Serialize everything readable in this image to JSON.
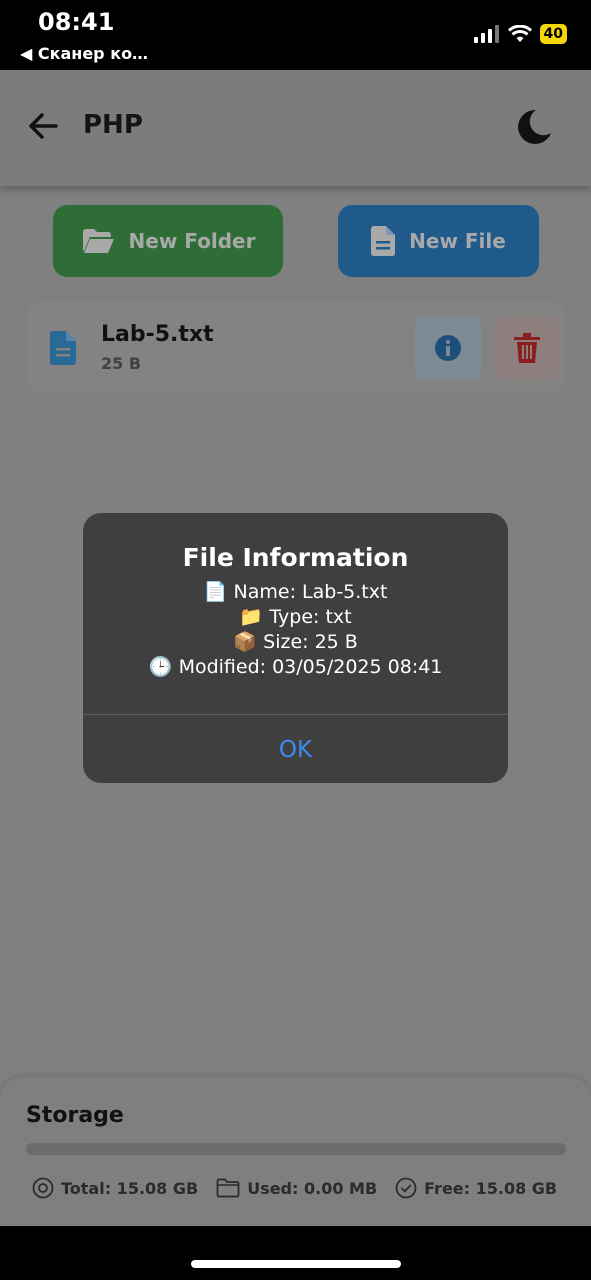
{
  "status_bar": {
    "time": "08:41",
    "back_app": "◀ Сканер ко…",
    "battery": "40"
  },
  "header": {
    "title": "PHP",
    "back_icon": "arrow-left-icon",
    "theme_icon": "moon-icon"
  },
  "actions": {
    "new_folder": "New Folder",
    "new_file": "New File"
  },
  "files": [
    {
      "name": "Lab-5.txt",
      "size": "25 B"
    }
  ],
  "storage": {
    "title": "Storage",
    "used_fraction": 0.0,
    "total": "Total: 15.08 GB",
    "used": "Used: 0.00 MB",
    "free": "Free: 15.08 GB"
  },
  "dialog": {
    "title": "File Information",
    "name_line": "Name: Lab-5.txt",
    "type_line": "Type: txt",
    "size_line": "Size: 25 B",
    "modified_line": "Modified: 03/05/2025 08:41",
    "ok": "OK"
  },
  "colors": {
    "folder_button": "#2f6d36",
    "file_button": "#1f5a8a",
    "ok_text": "#3b8cf0",
    "dialog_bg": "#3f3f3f"
  }
}
